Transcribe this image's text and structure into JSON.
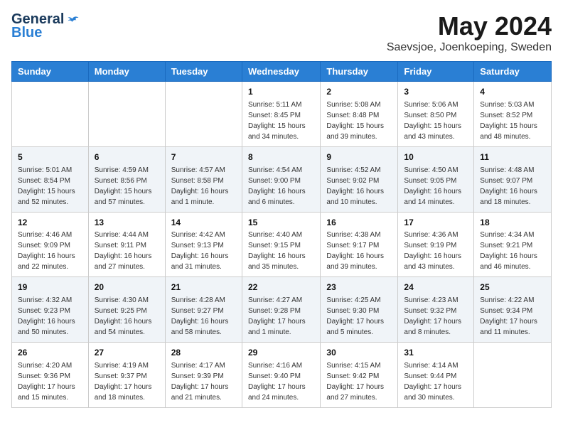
{
  "logo": {
    "general": "General",
    "blue": "Blue"
  },
  "title": "May 2024",
  "subtitle": "Saevsjoe, Joenkoeping, Sweden",
  "weekdays": [
    "Sunday",
    "Monday",
    "Tuesday",
    "Wednesday",
    "Thursday",
    "Friday",
    "Saturday"
  ],
  "weeks": [
    [
      {
        "day": null,
        "info": ""
      },
      {
        "day": null,
        "info": ""
      },
      {
        "day": null,
        "info": ""
      },
      {
        "day": "1",
        "info": "Sunrise: 5:11 AM\nSunset: 8:45 PM\nDaylight: 15 hours and 34 minutes."
      },
      {
        "day": "2",
        "info": "Sunrise: 5:08 AM\nSunset: 8:48 PM\nDaylight: 15 hours and 39 minutes."
      },
      {
        "day": "3",
        "info": "Sunrise: 5:06 AM\nSunset: 8:50 PM\nDaylight: 15 hours and 43 minutes."
      },
      {
        "day": "4",
        "info": "Sunrise: 5:03 AM\nSunset: 8:52 PM\nDaylight: 15 hours and 48 minutes."
      }
    ],
    [
      {
        "day": "5",
        "info": "Sunrise: 5:01 AM\nSunset: 8:54 PM\nDaylight: 15 hours and 52 minutes."
      },
      {
        "day": "6",
        "info": "Sunrise: 4:59 AM\nSunset: 8:56 PM\nDaylight: 15 hours and 57 minutes."
      },
      {
        "day": "7",
        "info": "Sunrise: 4:57 AM\nSunset: 8:58 PM\nDaylight: 16 hours and 1 minute."
      },
      {
        "day": "8",
        "info": "Sunrise: 4:54 AM\nSunset: 9:00 PM\nDaylight: 16 hours and 6 minutes."
      },
      {
        "day": "9",
        "info": "Sunrise: 4:52 AM\nSunset: 9:02 PM\nDaylight: 16 hours and 10 minutes."
      },
      {
        "day": "10",
        "info": "Sunrise: 4:50 AM\nSunset: 9:05 PM\nDaylight: 16 hours and 14 minutes."
      },
      {
        "day": "11",
        "info": "Sunrise: 4:48 AM\nSunset: 9:07 PM\nDaylight: 16 hours and 18 minutes."
      }
    ],
    [
      {
        "day": "12",
        "info": "Sunrise: 4:46 AM\nSunset: 9:09 PM\nDaylight: 16 hours and 22 minutes."
      },
      {
        "day": "13",
        "info": "Sunrise: 4:44 AM\nSunset: 9:11 PM\nDaylight: 16 hours and 27 minutes."
      },
      {
        "day": "14",
        "info": "Sunrise: 4:42 AM\nSunset: 9:13 PM\nDaylight: 16 hours and 31 minutes."
      },
      {
        "day": "15",
        "info": "Sunrise: 4:40 AM\nSunset: 9:15 PM\nDaylight: 16 hours and 35 minutes."
      },
      {
        "day": "16",
        "info": "Sunrise: 4:38 AM\nSunset: 9:17 PM\nDaylight: 16 hours and 39 minutes."
      },
      {
        "day": "17",
        "info": "Sunrise: 4:36 AM\nSunset: 9:19 PM\nDaylight: 16 hours and 43 minutes."
      },
      {
        "day": "18",
        "info": "Sunrise: 4:34 AM\nSunset: 9:21 PM\nDaylight: 16 hours and 46 minutes."
      }
    ],
    [
      {
        "day": "19",
        "info": "Sunrise: 4:32 AM\nSunset: 9:23 PM\nDaylight: 16 hours and 50 minutes."
      },
      {
        "day": "20",
        "info": "Sunrise: 4:30 AM\nSunset: 9:25 PM\nDaylight: 16 hours and 54 minutes."
      },
      {
        "day": "21",
        "info": "Sunrise: 4:28 AM\nSunset: 9:27 PM\nDaylight: 16 hours and 58 minutes."
      },
      {
        "day": "22",
        "info": "Sunrise: 4:27 AM\nSunset: 9:28 PM\nDaylight: 17 hours and 1 minute."
      },
      {
        "day": "23",
        "info": "Sunrise: 4:25 AM\nSunset: 9:30 PM\nDaylight: 17 hours and 5 minutes."
      },
      {
        "day": "24",
        "info": "Sunrise: 4:23 AM\nSunset: 9:32 PM\nDaylight: 17 hours and 8 minutes."
      },
      {
        "day": "25",
        "info": "Sunrise: 4:22 AM\nSunset: 9:34 PM\nDaylight: 17 hours and 11 minutes."
      }
    ],
    [
      {
        "day": "26",
        "info": "Sunrise: 4:20 AM\nSunset: 9:36 PM\nDaylight: 17 hours and 15 minutes."
      },
      {
        "day": "27",
        "info": "Sunrise: 4:19 AM\nSunset: 9:37 PM\nDaylight: 17 hours and 18 minutes."
      },
      {
        "day": "28",
        "info": "Sunrise: 4:17 AM\nSunset: 9:39 PM\nDaylight: 17 hours and 21 minutes."
      },
      {
        "day": "29",
        "info": "Sunrise: 4:16 AM\nSunset: 9:40 PM\nDaylight: 17 hours and 24 minutes."
      },
      {
        "day": "30",
        "info": "Sunrise: 4:15 AM\nSunset: 9:42 PM\nDaylight: 17 hours and 27 minutes."
      },
      {
        "day": "31",
        "info": "Sunrise: 4:14 AM\nSunset: 9:44 PM\nDaylight: 17 hours and 30 minutes."
      },
      {
        "day": null,
        "info": ""
      }
    ]
  ]
}
